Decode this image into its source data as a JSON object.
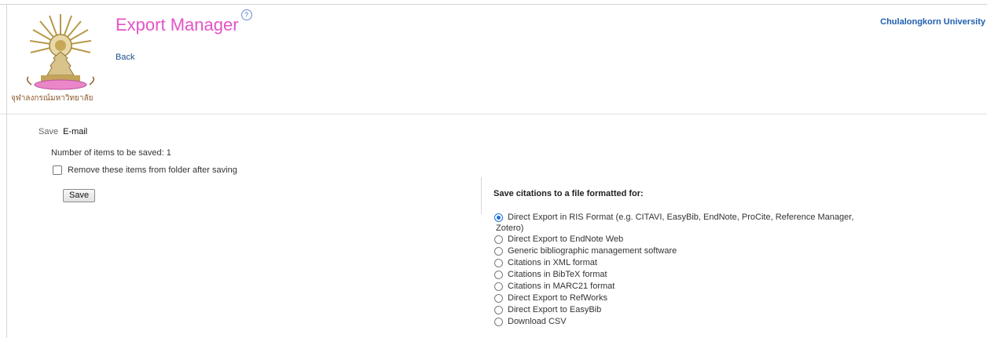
{
  "header": {
    "title": "Export Manager",
    "help_icon": "?",
    "back_link": "Back",
    "institution": "Chulalongkorn University",
    "logo_caption": "จุฬาลงกรณ์มหาวิทยาลัย"
  },
  "save_tabs": {
    "save": "Save",
    "email": "E-mail"
  },
  "items_count_text": "Number of items to be saved: 1",
  "remove_label": "Remove these items from folder after saving",
  "save_button": "Save",
  "formats": {
    "heading": "Save citations to a file formatted for:",
    "options": [
      {
        "label_a": "Direct Export in RIS Format (e.g. CITAVI, EasyBib, EndNote, ProCite, Reference Manager,",
        "label_b": "Zotero)",
        "selected": true
      },
      {
        "label": "Direct Export to EndNote Web",
        "selected": false
      },
      {
        "label": "Generic bibliographic management software",
        "selected": false
      },
      {
        "label": "Citations in XML format",
        "selected": false
      },
      {
        "label": "Citations in BibTeX format",
        "selected": false
      },
      {
        "label": "Citations in MARC21 format",
        "selected": false
      },
      {
        "label": "Direct Export to RefWorks",
        "selected": false
      },
      {
        "label": "Direct Export to EasyBib",
        "selected": false
      },
      {
        "label": "Download CSV",
        "selected": false
      }
    ]
  },
  "colors": {
    "title": "#e454c8",
    "link": "#1f4e8c",
    "institution": "#1f5fb0",
    "radio_selected": "#1a6fd8"
  }
}
